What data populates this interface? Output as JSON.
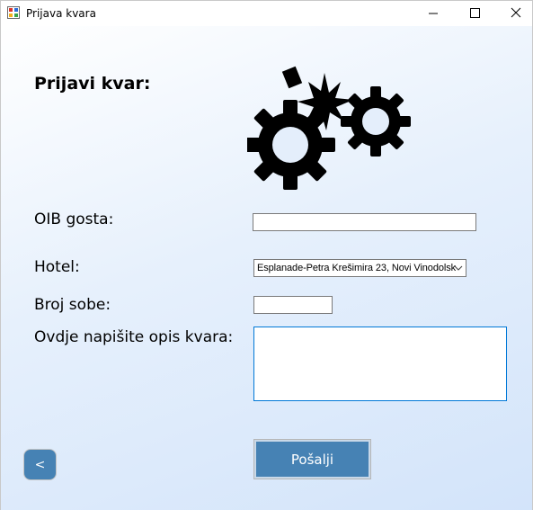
{
  "window": {
    "title": "Prijava kvara",
    "minimize_glyph": "—",
    "maximize_glyph": "☐",
    "close_glyph": "✕"
  },
  "form": {
    "heading": "Prijavi kvar:",
    "oib_label": "OIB  gosta:",
    "oib_value": "",
    "hotel_label": "Hotel:",
    "hotel_selected": "Esplanade-Petra Krešimira 23, Novi Vinodolsk",
    "room_label": "Broj sobe:",
    "room_value": "",
    "description_label": "Ovdje napišite opis kvara:",
    "description_value": "",
    "submit_label": "Pošalji",
    "back_label": "<"
  },
  "colors": {
    "button_blue": "#4682b4",
    "focus_border": "#0078d7"
  },
  "icons": {
    "app": "form-icon",
    "illustration": "gears-icon"
  }
}
